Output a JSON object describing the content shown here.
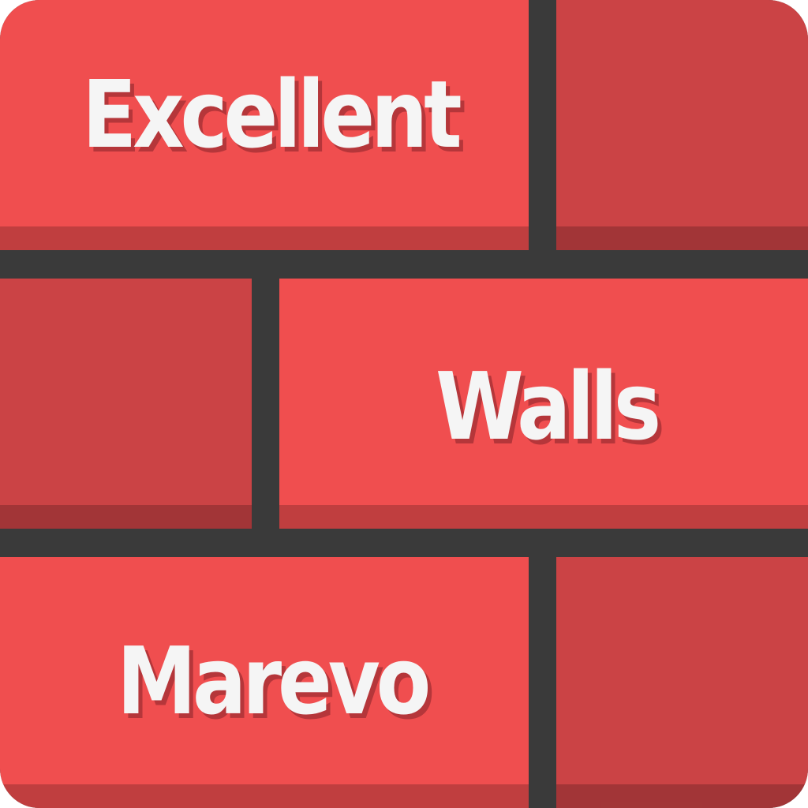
{
  "words": {
    "top": "Excellent",
    "middle": "Walls",
    "bottom": "Marevo"
  },
  "colors": {
    "mortar": "#3a3a3a",
    "brick_primary": "#f04e4f",
    "brick_secondary": "#cb4345",
    "text": "#f5f5f5",
    "text_shadow": "#b5363a"
  }
}
